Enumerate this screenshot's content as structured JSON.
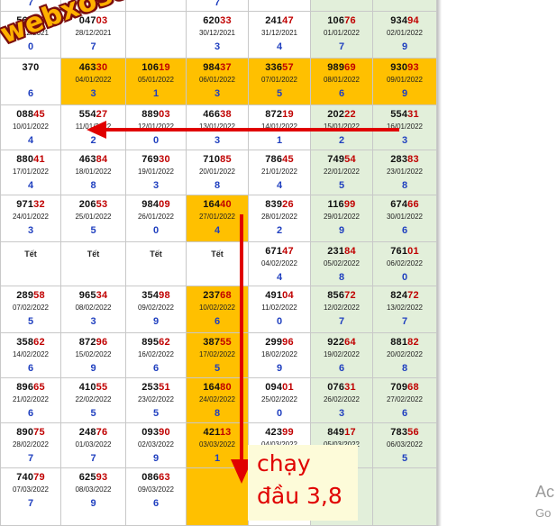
{
  "watermark": "webxoso.net",
  "annotation": {
    "line1": "chạy",
    "line2": "đầu 3,8"
  },
  "os_overlay": {
    "line1": "Ac",
    "line2": "Go"
  },
  "colors": {
    "highlight": "#ffc000",
    "weekend": "#e2efda",
    "tail": "#c00000",
    "digit": "#1f3fbf",
    "arrow": "#e00000"
  },
  "top_partial": [
    "7",
    "8",
    "",
    "7",
    "",
    "",
    ""
  ],
  "rows": [
    [
      {
        "head": "569",
        "tail": "03",
        "date": "27/12/2021",
        "d": "0"
      },
      {
        "head": "047",
        "tail": "03",
        "date": "28/12/2021",
        "d": "7"
      },
      {
        "head": "",
        "tail": "",
        "date": "",
        "d": ""
      },
      {
        "head": "620",
        "tail": "33",
        "date": "30/12/2021",
        "d": "3"
      },
      {
        "head": "241",
        "tail": "47",
        "date": "31/12/2021",
        "d": "4"
      },
      {
        "head": "106",
        "tail": "76",
        "date": "01/01/2022",
        "d": "7"
      },
      {
        "head": "934",
        "tail": "94",
        "date": "02/01/2022",
        "d": "9"
      }
    ],
    [
      {
        "head": "370",
        "tail": "",
        "date": "",
        "d": "6"
      },
      {
        "head": "463",
        "tail": "30",
        "date": "04/01/2022",
        "d": "3",
        "hl": true
      },
      {
        "head": "106",
        "tail": "19",
        "date": "05/01/2022",
        "d": "1",
        "hl": true
      },
      {
        "head": "984",
        "tail": "37",
        "date": "06/01/2022",
        "d": "3",
        "hl": true
      },
      {
        "head": "336",
        "tail": "57",
        "date": "07/01/2022",
        "d": "5",
        "hl": true
      },
      {
        "head": "989",
        "tail": "69",
        "date": "08/01/2022",
        "d": "6",
        "hl": true
      },
      {
        "head": "930",
        "tail": "93",
        "date": "09/01/2022",
        "d": "9",
        "hl": true
      }
    ],
    [
      {
        "head": "088",
        "tail": "45",
        "date": "10/01/2022",
        "d": "4"
      },
      {
        "head": "554",
        "tail": "27",
        "date": "11/01/2022",
        "d": "2"
      },
      {
        "head": "889",
        "tail": "03",
        "date": "12/01/2022",
        "d": "0"
      },
      {
        "head": "466",
        "tail": "38",
        "date": "13/01/2022",
        "d": "3"
      },
      {
        "head": "872",
        "tail": "19",
        "date": "14/01/2022",
        "d": "1"
      },
      {
        "head": "202",
        "tail": "22",
        "date": "15/01/2022",
        "d": "2"
      },
      {
        "head": "554",
        "tail": "31",
        "date": "16/01/2022",
        "d": "3"
      }
    ],
    [
      {
        "head": "880",
        "tail": "41",
        "date": "17/01/2022",
        "d": "4"
      },
      {
        "head": "463",
        "tail": "84",
        "date": "18/01/2022",
        "d": "8"
      },
      {
        "head": "769",
        "tail": "30",
        "date": "19/01/2022",
        "d": "3"
      },
      {
        "head": "710",
        "tail": "85",
        "date": "20/01/2022",
        "d": "8"
      },
      {
        "head": "786",
        "tail": "45",
        "date": "21/01/2022",
        "d": "4"
      },
      {
        "head": "749",
        "tail": "54",
        "date": "22/01/2022",
        "d": "5"
      },
      {
        "head": "283",
        "tail": "83",
        "date": "23/01/2022",
        "d": "8"
      }
    ],
    [
      {
        "head": "971",
        "tail": "32",
        "date": "24/01/2022",
        "d": "3"
      },
      {
        "head": "206",
        "tail": "53",
        "date": "25/01/2022",
        "d": "5"
      },
      {
        "head": "984",
        "tail": "09",
        "date": "26/01/2022",
        "d": "0"
      },
      {
        "head": "164",
        "tail": "40",
        "date": "27/01/2022",
        "d": "4",
        "hl": true
      },
      {
        "head": "839",
        "tail": "26",
        "date": "28/01/2022",
        "d": "2"
      },
      {
        "head": "116",
        "tail": "99",
        "date": "29/01/2022",
        "d": "9"
      },
      {
        "head": "674",
        "tail": "66",
        "date": "30/01/2022",
        "d": "6"
      }
    ],
    [
      {
        "tet": "Tết"
      },
      {
        "tet": "Tết"
      },
      {
        "tet": "Tết"
      },
      {
        "tet": "Tết"
      },
      {
        "head": "671",
        "tail": "47",
        "date": "04/02/2022",
        "d": "4"
      },
      {
        "head": "231",
        "tail": "84",
        "date": "05/02/2022",
        "d": "8"
      },
      {
        "head": "761",
        "tail": "01",
        "date": "06/02/2022",
        "d": "0"
      }
    ],
    [
      {
        "head": "289",
        "tail": "58",
        "date": "07/02/2022",
        "d": "5"
      },
      {
        "head": "965",
        "tail": "34",
        "date": "08/02/2022",
        "d": "3"
      },
      {
        "head": "354",
        "tail": "98",
        "date": "09/02/2022",
        "d": "9"
      },
      {
        "head": "237",
        "tail": "68",
        "date": "10/02/2022",
        "d": "6",
        "hl": true
      },
      {
        "head": "491",
        "tail": "04",
        "date": "11/02/2022",
        "d": "0"
      },
      {
        "head": "856",
        "tail": "72",
        "date": "12/02/2022",
        "d": "7"
      },
      {
        "head": "824",
        "tail": "72",
        "date": "13/02/2022",
        "d": "7"
      }
    ],
    [
      {
        "head": "358",
        "tail": "62",
        "date": "14/02/2022",
        "d": "6"
      },
      {
        "head": "872",
        "tail": "96",
        "date": "15/02/2022",
        "d": "9"
      },
      {
        "head": "895",
        "tail": "62",
        "date": "16/02/2022",
        "d": "6"
      },
      {
        "head": "387",
        "tail": "55",
        "date": "17/02/2022",
        "d": "5",
        "hl": true
      },
      {
        "head": "299",
        "tail": "96",
        "date": "18/02/2022",
        "d": "9"
      },
      {
        "head": "922",
        "tail": "64",
        "date": "19/02/2022",
        "d": "6"
      },
      {
        "head": "881",
        "tail": "82",
        "date": "20/02/2022",
        "d": "8"
      }
    ],
    [
      {
        "head": "896",
        "tail": "65",
        "date": "21/02/2022",
        "d": "6"
      },
      {
        "head": "410",
        "tail": "55",
        "date": "22/02/2022",
        "d": "5"
      },
      {
        "head": "253",
        "tail": "51",
        "date": "23/02/2022",
        "d": "5"
      },
      {
        "head": "164",
        "tail": "80",
        "date": "24/02/2022",
        "d": "8",
        "hl": true
      },
      {
        "head": "094",
        "tail": "01",
        "date": "25/02/2022",
        "d": "0"
      },
      {
        "head": "076",
        "tail": "31",
        "date": "26/02/2022",
        "d": "3"
      },
      {
        "head": "709",
        "tail": "68",
        "date": "27/02/2022",
        "d": "6"
      }
    ],
    [
      {
        "head": "890",
        "tail": "75",
        "date": "28/02/2022",
        "d": "7"
      },
      {
        "head": "248",
        "tail": "76",
        "date": "01/03/2022",
        "d": "7"
      },
      {
        "head": "093",
        "tail": "90",
        "date": "02/03/2022",
        "d": "9"
      },
      {
        "head": "421",
        "tail": "13",
        "date": "03/03/2022",
        "d": "1",
        "hl": true
      },
      {
        "head": "423",
        "tail": "99",
        "date": "04/03/2022",
        "d": "9"
      },
      {
        "head": "849",
        "tail": "17",
        "date": "05/03/2022",
        "d": "1"
      },
      {
        "head": "783",
        "tail": "56",
        "date": "06/03/2022",
        "d": "5"
      }
    ],
    [
      {
        "head": "740",
        "tail": "79",
        "date": "07/03/2022",
        "d": "7"
      },
      {
        "head": "625",
        "tail": "93",
        "date": "08/03/2022",
        "d": "9"
      },
      {
        "head": "086",
        "tail": "63",
        "date": "09/03/2022",
        "d": "6"
      },
      {
        "blank": true,
        "hl": true
      },
      {
        "blank": true
      },
      {
        "blank": true
      },
      {
        "blank": true
      }
    ]
  ]
}
